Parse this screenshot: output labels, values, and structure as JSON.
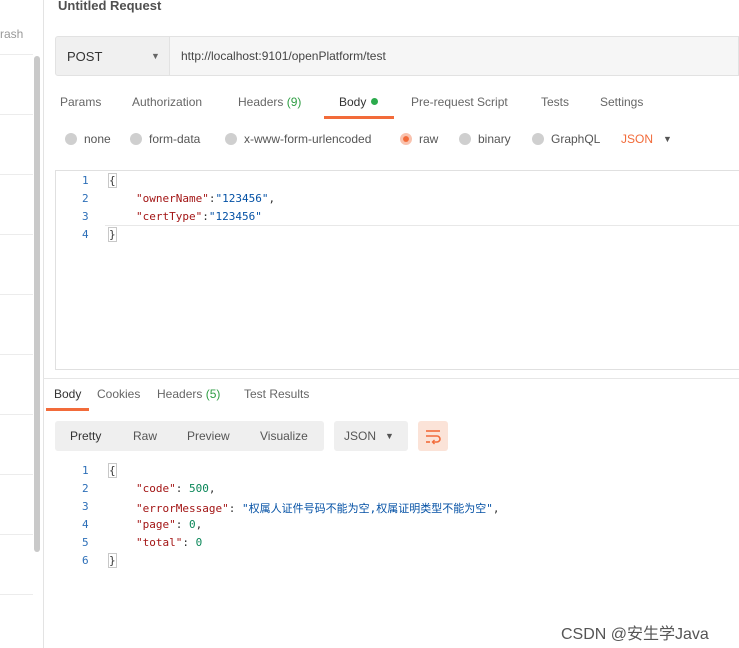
{
  "sidebar": {
    "trash_label": "rash"
  },
  "request": {
    "title": "Untitled Request",
    "method": "POST",
    "url": "http://localhost:9101/openPlatform/test",
    "tabs": {
      "params": "Params",
      "authorization": "Authorization",
      "headers": "Headers",
      "headers_count": "(9)",
      "body": "Body",
      "prerequest": "Pre-request Script",
      "tests": "Tests",
      "settings": "Settings"
    },
    "body_types": {
      "none": "none",
      "form_data": "form-data",
      "urlencoded": "x-www-form-urlencoded",
      "raw": "raw",
      "binary": "binary",
      "graphql": "GraphQL"
    },
    "selected_body_type": "raw",
    "raw_format": "JSON",
    "lines": [
      "1",
      "2",
      "3",
      "4"
    ],
    "body": {
      "open": "{",
      "k1": "\"ownerName\"",
      "v1": "\"123456\"",
      "k2": "\"certType\"",
      "v2": "\"123456\"",
      "close": "}"
    }
  },
  "response": {
    "tabs": {
      "body": "Body",
      "cookies": "Cookies",
      "headers": "Headers",
      "headers_count": "(5)",
      "test_results": "Test Results"
    },
    "views": {
      "pretty": "Pretty",
      "raw": "Raw",
      "preview": "Preview",
      "visualize": "Visualize"
    },
    "format": "JSON",
    "lines": [
      "1",
      "2",
      "3",
      "4",
      "5",
      "6"
    ],
    "body": {
      "open": "{",
      "k_code": "\"code\"",
      "v_code": "500",
      "k_err": "\"errorMessage\"",
      "v_err": "\"权属人证件号码不能为空,权属证明类型不能为空\"",
      "k_page": "\"page\"",
      "v_page": "0",
      "k_total": "\"total\"",
      "v_total": "0",
      "close": "}"
    }
  },
  "watermark": "CSDN @安生学Java",
  "colors": {
    "accent": "#f26b3a",
    "count_green": "#2f9e44",
    "dot_green": "#2cab4d",
    "line_numbers": "#2d6fb8"
  }
}
